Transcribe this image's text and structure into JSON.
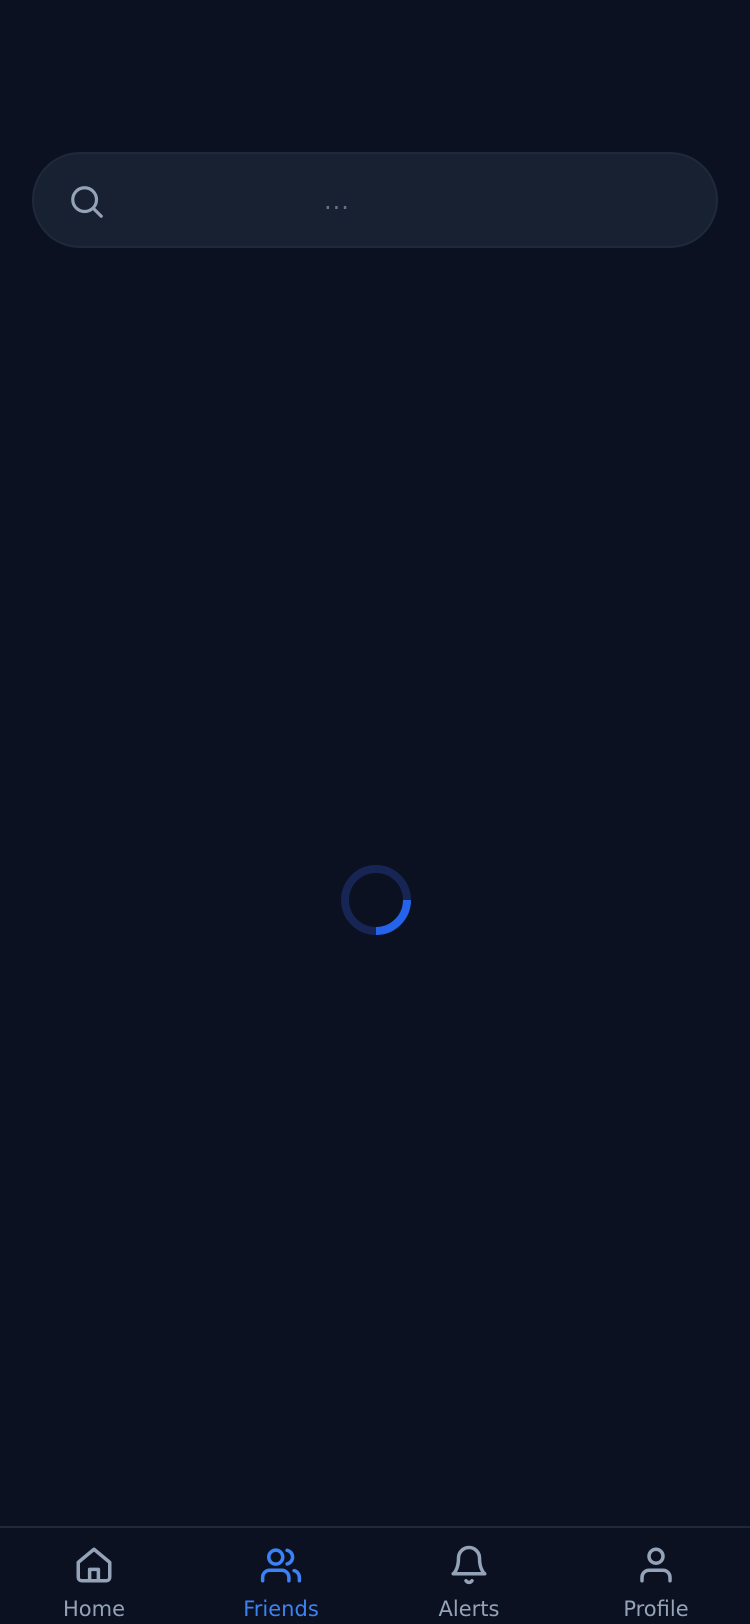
{
  "search": {
    "value": "...",
    "icon": "search-icon"
  },
  "loading": {
    "icon": "loading-spinner",
    "track_color": "#172554",
    "arc_color": "#2563eb",
    "progress": 0.25
  },
  "tabbar": {
    "active_color": "#3b82f6",
    "inactive_color": "#94a3b8",
    "items": [
      {
        "label": "Home",
        "icon": "home-icon",
        "active": false
      },
      {
        "label": "Friends",
        "icon": "friends-icon",
        "active": true
      },
      {
        "label": "Alerts",
        "icon": "bell-icon",
        "active": false
      },
      {
        "label": "Profile",
        "icon": "profile-icon",
        "active": false
      }
    ]
  }
}
